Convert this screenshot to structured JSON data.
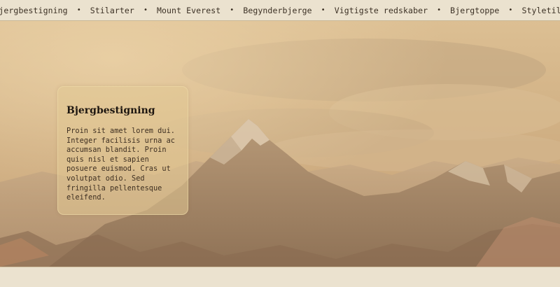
{
  "nav": {
    "items": [
      {
        "label": "Bjergbestigning"
      },
      {
        "label": "Stilarter"
      },
      {
        "label": "Mount Everest"
      },
      {
        "label": "Begynderbjerge"
      },
      {
        "label": "Vigtigste redskaber"
      },
      {
        "label": "Bjergtoppe"
      },
      {
        "label": "Styletile"
      }
    ],
    "separator": "•"
  },
  "card": {
    "title": "Bjergbestigning",
    "text": "Proin sit amet lorem dui.\nInteger facilisis urna ac\naccumsan blandit. Proin\nquis nisl et sapien\nposuere euismod. Cras ut\nvolutpat odio. Sed\nfringilla pellentesque\neleifend."
  },
  "colors": {
    "background": "#ebe2cf",
    "hero_tint": "#d7b384",
    "text": "#3b3024"
  }
}
